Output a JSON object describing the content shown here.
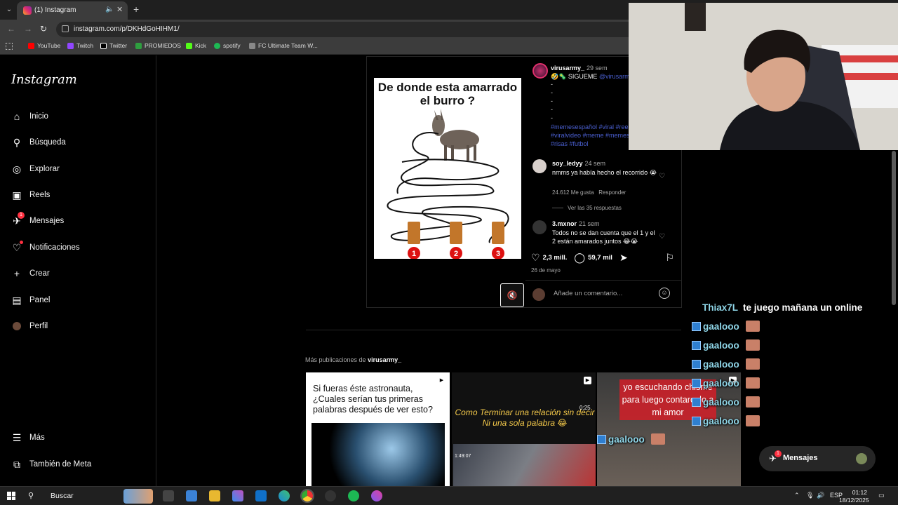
{
  "browser": {
    "tab_title": "(1) Instagram",
    "url": "instagram.com/p/DKHdGoHIHM1/",
    "bookmarks": [
      "YouTube",
      "Twitch",
      "Twitter",
      "PROMIEDOS",
      "Kick",
      "spotify",
      "FC Ultimate Team W..."
    ]
  },
  "sidebar": {
    "logo": "Instagram",
    "items": [
      {
        "label": "Inicio",
        "icon": "home-icon"
      },
      {
        "label": "Búsqueda",
        "icon": "search-icon"
      },
      {
        "label": "Explorar",
        "icon": "compass-icon"
      },
      {
        "label": "Reels",
        "icon": "reels-icon"
      },
      {
        "label": "Mensajes",
        "icon": "messenger-icon",
        "badge": "1"
      },
      {
        "label": "Notificaciones",
        "icon": "heart-icon"
      },
      {
        "label": "Crear",
        "icon": "plus-icon"
      },
      {
        "label": "Panel",
        "icon": "chart-icon"
      },
      {
        "label": "Perfil",
        "icon": "avatar-icon"
      }
    ],
    "bottom": [
      {
        "label": "Más",
        "icon": "menu-icon"
      },
      {
        "label": "También de Meta",
        "icon": "meta-icon"
      }
    ]
  },
  "post": {
    "meme_title": "De donde esta amarrado el burro ?",
    "meme_numbers": [
      "1",
      "2",
      "3"
    ],
    "author": "virusarmy_",
    "author_time": "29 sem",
    "caption_lead": "🤣🦠 SIGUEME",
    "caption_mention": "@virusarmy",
    "caption_dashes": [
      "-",
      "-",
      "-",
      "-",
      "-"
    ],
    "hashtags": "#memesespañol #viral #reels #viralvideo #meme #memes #risas #futbol",
    "comments": [
      {
        "user": "soy_ledyy",
        "time": "24 sem",
        "text": "nmms ya había hecho el recorrido 😭",
        "likes": "24.612 Me gusta",
        "reply": "Responder"
      },
      {
        "user": "3.mxnor",
        "time": "21 sem",
        "text": "Todos no se dan cuenta que el 1 y el 2 están amarados juntos 😂😭"
      }
    ],
    "replies_label": "Ver las 35 respuestas",
    "likes": "2,3 mill.",
    "comments_count": "59,7 mil",
    "date": "26 de mayo",
    "comment_placeholder": "Añade un comentario..."
  },
  "more": {
    "label_prefix": "Más publicaciones de",
    "label_user": "virusarmy_",
    "thumb1_text": "Si fueras éste astronauta, ¿Cuales serían tus primeras palabras después de ver esto?",
    "thumb2_text": "Como Terminar una relación sin decir Ni una sola palabra 😂",
    "thumb2_duration": "0:25",
    "thumb2_timestamp": "1:49:07",
    "thumb3_text": "yo escuchando chisme para luego contarcelo a mi amor"
  },
  "chat": {
    "first_user": "Thiax7L",
    "first_text": "te juego mañana un online",
    "repeat_user": "gaalooo",
    "repeat_count": 7
  },
  "messages_pill": {
    "label": "Mensajes",
    "badge": "1"
  },
  "taskbar": {
    "search": "Buscar",
    "lang": "ESP",
    "time": "01:12",
    "date": "18/12/2025"
  }
}
